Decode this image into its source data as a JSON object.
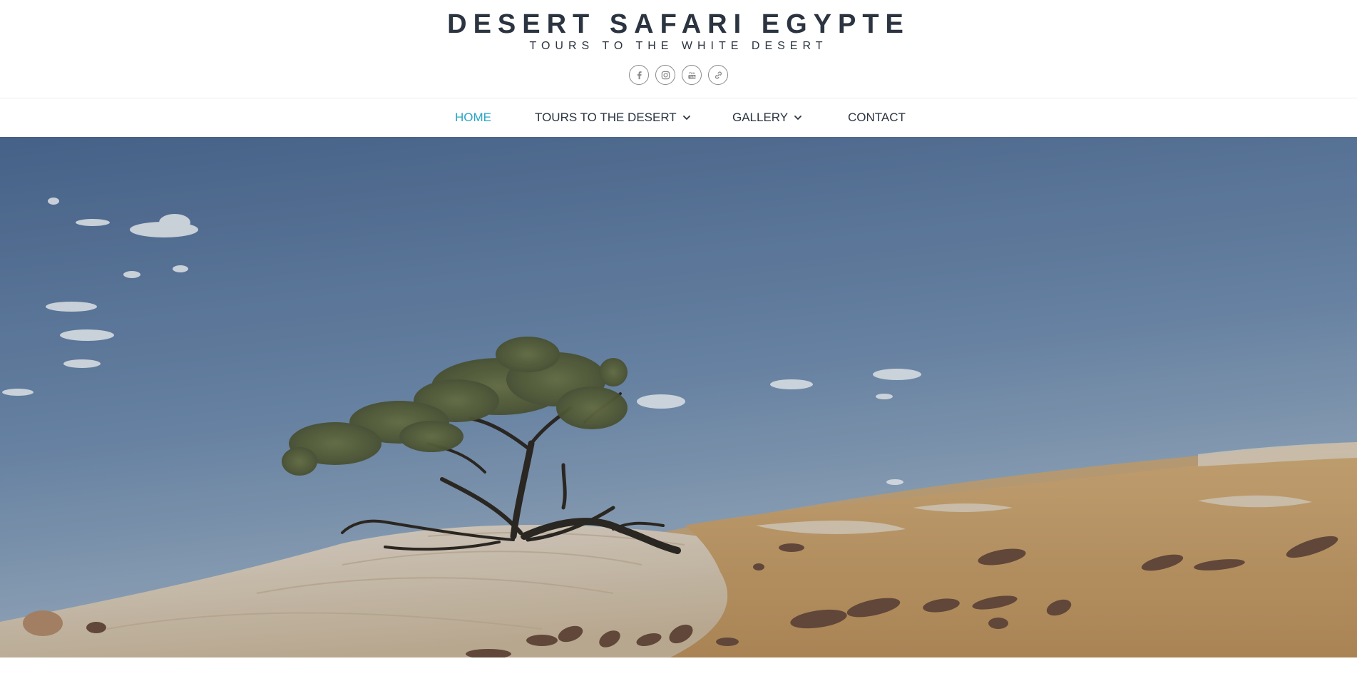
{
  "site": {
    "title": "DESERT SAFARI EGYPTE",
    "tagline": "TOURS TO THE WHITE DESERT"
  },
  "social": [
    {
      "icon": "facebook-icon",
      "label": "Facebook"
    },
    {
      "icon": "instagram-icon",
      "label": "Instagram"
    },
    {
      "icon": "youtube-icon",
      "label": "YouTube"
    },
    {
      "icon": "link-icon",
      "label": "Link"
    }
  ],
  "nav": {
    "items": [
      {
        "label": "HOME",
        "active": true,
        "has_dropdown": false
      },
      {
        "label": "TOURS TO THE DESERT",
        "active": false,
        "has_dropdown": true
      },
      {
        "label": "GALLERY",
        "active": false,
        "has_dropdown": true
      },
      {
        "label": "CONTACT",
        "active": false,
        "has_dropdown": false
      }
    ]
  },
  "colors": {
    "title": "#2b3440",
    "accent": "#2aa6c6",
    "icon_border": "#8a8a8a",
    "sky_top": "#4c6a93",
    "sky_bottom": "#9fb3c8",
    "sand": "#c9a36e",
    "white_rock": "#d9d0c3"
  }
}
